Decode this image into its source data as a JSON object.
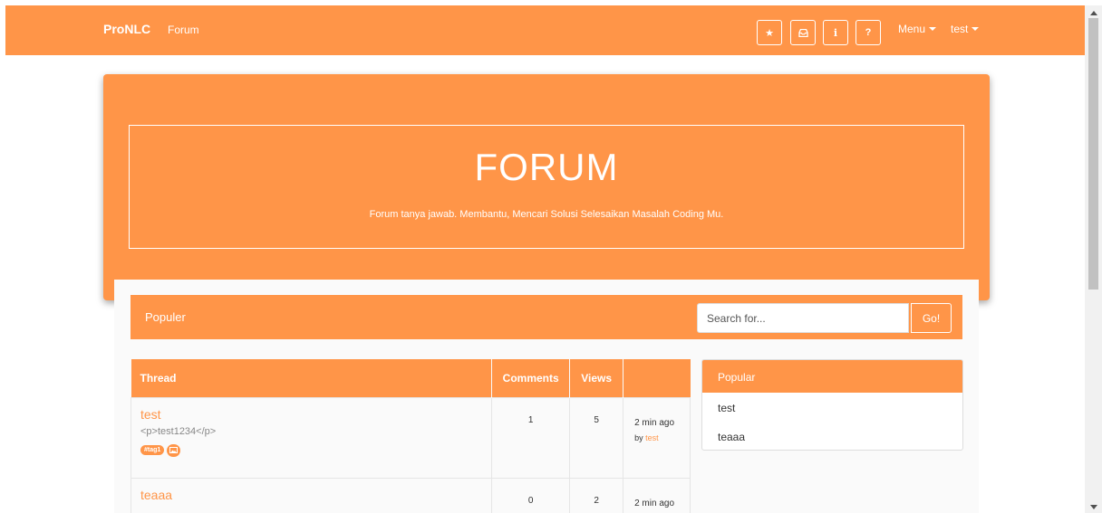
{
  "navbar": {
    "brand": "ProNLC",
    "forum_link": "Forum",
    "icon_buttons": [
      {
        "name": "star-icon",
        "glyph": "★"
      },
      {
        "name": "inbox-icon",
        "glyph": ""
      },
      {
        "name": "info-icon",
        "glyph": "i"
      },
      {
        "name": "help-icon",
        "glyph": "?"
      }
    ],
    "menu_label": "Menu",
    "user_label": "test"
  },
  "hero": {
    "title": "FORUM",
    "subtitle": "Forum tanya jawab. Membantu, Mencari Solusi Selesaikan Masalah Coding Mu."
  },
  "popular_bar": {
    "label": "Populer",
    "search_placeholder": "Search for...",
    "go_label": "Go!"
  },
  "thread_table": {
    "columns": [
      "Thread",
      "Comments",
      "Views",
      ""
    ],
    "rows": [
      {
        "title": "test",
        "excerpt": "<p>test1234</p>",
        "tag": "#tag1",
        "comments": "1",
        "views": "5",
        "time": "2 min ago",
        "by": "by",
        "author": "test"
      },
      {
        "title": "teaaa",
        "comments": "0",
        "views": "2",
        "time": "2 min ago"
      }
    ]
  },
  "side_panel": {
    "title": "Popular",
    "items": [
      "test",
      "teaaa"
    ]
  },
  "colors": {
    "accent": "#ff9548",
    "background": "#ffffff",
    "content_bg": "#fafafa"
  }
}
